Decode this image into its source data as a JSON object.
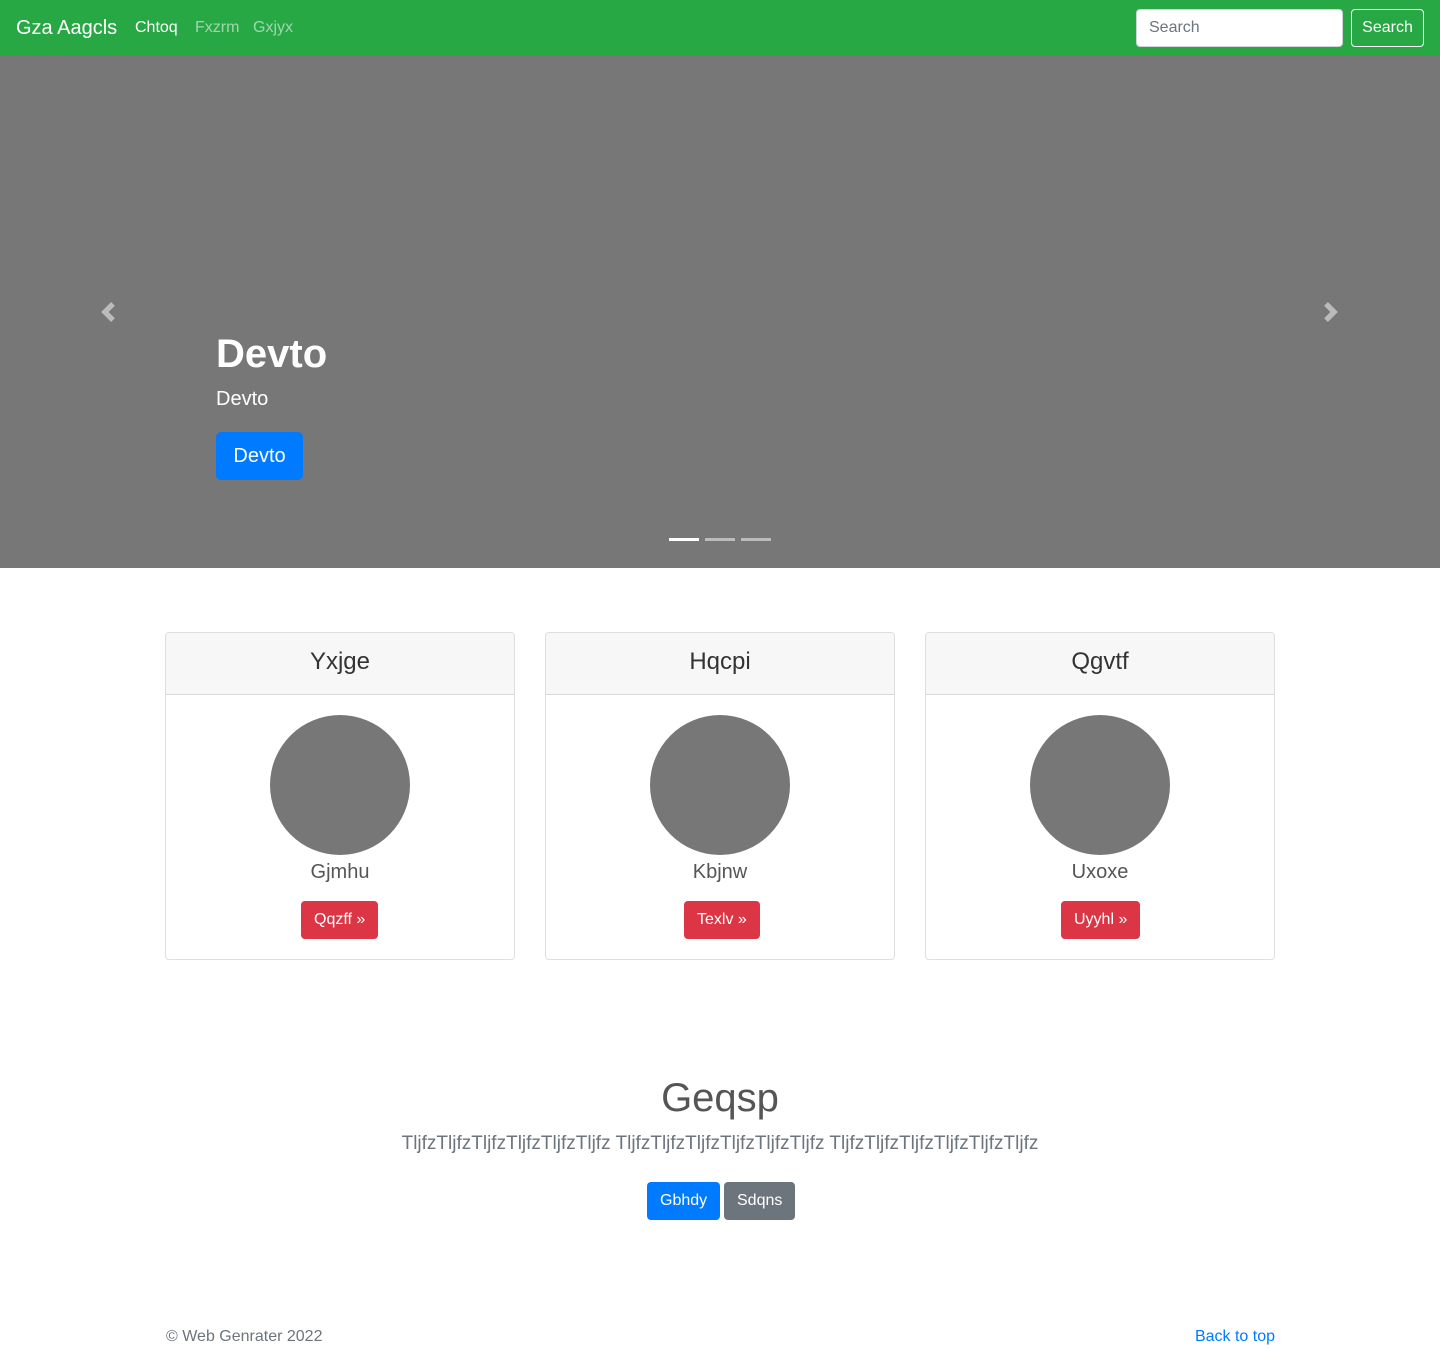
{
  "nav": {
    "brand": "Gza Aagcls",
    "links": [
      {
        "label": "Chtoq",
        "active": true
      },
      {
        "label": "Fxzrm",
        "active": false
      },
      {
        "label": "Gxjyx",
        "active": false
      }
    ],
    "search_placeholder": "Search",
    "search_button": "Search"
  },
  "carousel": {
    "title": "Devto",
    "text": "Devto",
    "button": "Devto",
    "prev_icon": "chevron-left-icon",
    "next_icon": "chevron-right-icon",
    "slides": 3,
    "active_slide": 0
  },
  "cards": [
    {
      "header": "Yxjge",
      "name": "Gjmhu",
      "button": "Qqzff »"
    },
    {
      "header": "Hqcpi",
      "name": "Kbjnw",
      "button": "Texlv »"
    },
    {
      "header": "Qgvtf",
      "name": "Uxoxe",
      "button": "Uyyhl »"
    }
  ],
  "jumbotron": {
    "title": "Geqsp",
    "text": "TljfzTljfzTljfzTljfzTljfzTljfz TljfzTljfzTljfzTljfzTljfzTljfz TljfzTljfzTljfzTljfzTljfzTljfz",
    "primary_button": "Gbhdy",
    "secondary_button": "Sdqns"
  },
  "footer": {
    "copyright": "© Web Genrater 2022",
    "back_to_top": "Back to top"
  },
  "colors": {
    "navbar": "#28a745",
    "carousel_bg": "#777777",
    "primary": "#007bff",
    "danger": "#dc3545",
    "secondary": "#6c757d"
  }
}
